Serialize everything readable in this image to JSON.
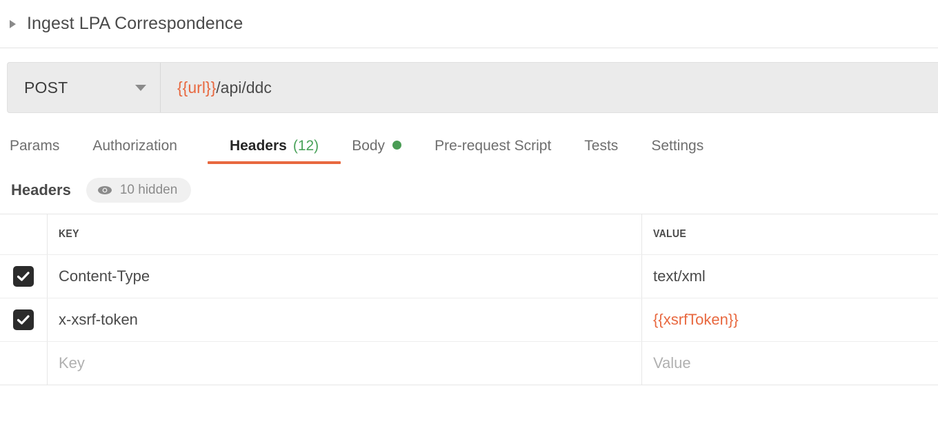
{
  "request": {
    "title": "Ingest LPA Correspondence",
    "collapse_icon": "triangle-right-icon",
    "method": "POST",
    "method_caret_icon": "chevron-down-icon",
    "url_variable": "{{url}}",
    "url_path": "/api/ddc"
  },
  "tabs": [
    {
      "label": "Params",
      "active": false
    },
    {
      "label": "Authorization",
      "active": false
    },
    {
      "label": "Headers",
      "active": true,
      "count": "(12)"
    },
    {
      "label": "Body",
      "active": false,
      "dot": true
    },
    {
      "label": "Pre-request Script",
      "active": false
    },
    {
      "label": "Tests",
      "active": false
    },
    {
      "label": "Settings",
      "active": false
    }
  ],
  "headers_section": {
    "label": "Headers",
    "hidden_pill": {
      "icon": "eye-icon",
      "text": "10 hidden"
    }
  },
  "table": {
    "columns": [
      "KEY",
      "VALUE"
    ],
    "rows": [
      {
        "checked": true,
        "key": "Content-Type",
        "value": "text/xml",
        "value_is_variable": false,
        "placeholder": false
      },
      {
        "checked": true,
        "key": "x-xsrf-token",
        "value": "{{xsrfToken}}",
        "value_is_variable": true,
        "placeholder": false
      },
      {
        "checked": false,
        "key": "Key",
        "value": "Value",
        "value_is_variable": false,
        "placeholder": true
      }
    ]
  },
  "colors": {
    "accent_orange": "#e8683f",
    "count_green": "#4aa25a",
    "body_dot_green": "#4a9c55",
    "url_bar_bg": "#ebebeb",
    "checkbox_dark": "#2b2b2b",
    "text_primary": "#4a4a4a",
    "text_muted": "#8b8b8b",
    "placeholder": "#b0b0b0"
  }
}
